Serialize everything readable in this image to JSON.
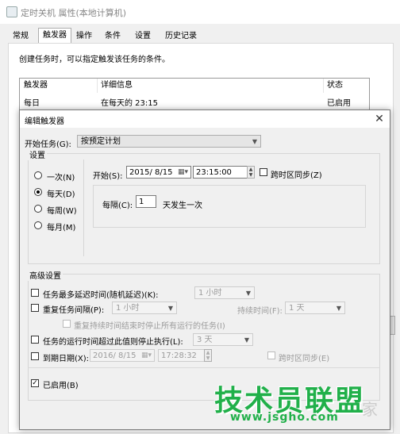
{
  "back_window": {
    "title": "定时关机 属性(本地计算机)",
    "tabs": [
      "常规",
      "触发器",
      "操作",
      "条件",
      "设置",
      "历史记录"
    ],
    "active_tab": "触发器",
    "description": "创建任务时，可以指定触发该任务的条件。",
    "table": {
      "headers": [
        "触发器",
        "详细信息",
        "状态"
      ],
      "rows": [
        [
          "每日",
          "在每天的 23:15",
          "已启用"
        ]
      ]
    }
  },
  "dialog": {
    "title": "编辑触发器",
    "close_glyph": "✕",
    "begin_task_label": "开始任务(G):",
    "begin_task_value": "按预定计划",
    "settings_legend": "设置",
    "schedule_options": [
      "一次(N)",
      "每天(D)",
      "每周(W)",
      "每月(M)"
    ],
    "selected_schedule": "每天(D)",
    "start_label": "开始(S):",
    "start_date": "2015/ 8/15",
    "start_time": "23:15:00",
    "sync_tz_label": "跨时区同步(Z)",
    "recur_label": "每隔(C):",
    "recur_value": "1",
    "recur_suffix": "天发生一次",
    "advanced_legend": "高级设置",
    "delay_label": "任务最多延迟时间(随机延迟)(K):",
    "delay_value": "1 小时",
    "repeat_label": "重复任务间隔(P):",
    "repeat_value": "1 小时",
    "duration_label": "持续时间(F):",
    "duration_value": "1 天",
    "stop_all_label": "重复持续时间结束时停止所有运行的任务(I)",
    "stop_longer_label": "任务的运行时间超过此值则停止执行(L):",
    "stop_longer_value": "3 天",
    "expire_label": "到期日期(X):",
    "expire_date": "2016/ 8/15",
    "expire_time": "17:28:32",
    "expire_sync_label": "跨时区同步(E)",
    "enabled_label": "已启用(B)",
    "enabled_checked": true
  },
  "watermark": {
    "text": "技术员联盟",
    "url": "www.jsgho.com",
    "tail": "家"
  },
  "colors": {
    "watermark": "#21b04a",
    "dialog_bg": "#f0f0f0"
  }
}
